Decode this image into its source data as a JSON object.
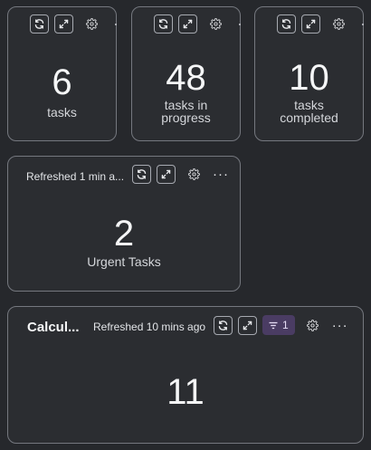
{
  "cards": [
    {
      "value": "6",
      "label": "tasks"
    },
    {
      "value": "48",
      "label": "tasks in\nprogress"
    },
    {
      "value": "10",
      "label": "tasks\ncompleted"
    },
    {
      "value": "2",
      "label": "Urgent Tasks",
      "refreshed": "Refreshed 1 min a..."
    },
    {
      "value": "11",
      "title": "Calcul...",
      "refreshed": "Refreshed 10 mins ago",
      "filter_count": "1"
    }
  ],
  "icons": {
    "refresh": "refresh-icon",
    "expand": "expand-icon",
    "settings": "gear-icon",
    "more": "more-horizontal-icon",
    "filter": "filter-icon"
  },
  "colors": {
    "background": "#26282c",
    "card": "#2b2d31",
    "border": "#75787f",
    "filter_badge": "#4a3c63"
  }
}
